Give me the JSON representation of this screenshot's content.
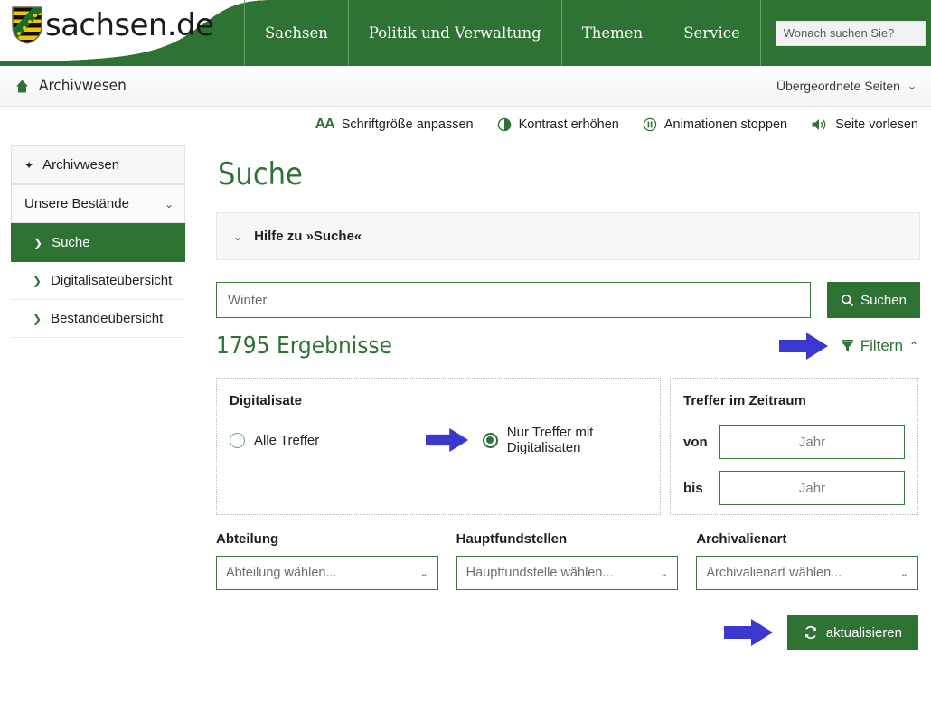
{
  "header": {
    "logo_text": "sachsen.de",
    "logo_icon": "saxony-coat-of-arms",
    "nav_items": [
      {
        "label": "Sachsen"
      },
      {
        "label": "Politik und Verwaltung"
      },
      {
        "label": "Themen"
      },
      {
        "label": "Service"
      }
    ],
    "search": {
      "placeholder": "Wonach suchen Sie?",
      "value": "",
      "button_icon": "search-icon"
    },
    "apps_icon": "grid-apps-icon",
    "green": "#2f7334"
  },
  "breadcrumb": {
    "home_icon": "home-icon",
    "current": "Archivwesen",
    "parent_pages_label": "Übergeordnete Seiten",
    "chevron_icon": "chevron-down-icon"
  },
  "accessibility": [
    {
      "icon": "font-size-icon",
      "label": "Schriftgröße anpassen"
    },
    {
      "icon": "contrast-icon",
      "label": "Kontrast erhöhen"
    },
    {
      "icon": "pause-icon",
      "label": "Animationen stoppen"
    },
    {
      "icon": "speaker-icon",
      "label": "Seite vorlesen"
    }
  ],
  "sidebar": {
    "items": [
      {
        "label": "Archivwesen",
        "bullet": "diamond-icon",
        "state": "header"
      },
      {
        "label": "Unsere Bestände",
        "bullet": "none",
        "state": "collapsible",
        "chevron": "chevron-down-icon"
      },
      {
        "label": "Suche",
        "bullet": "arrow-icon",
        "state": "active"
      },
      {
        "label": "Digitalisateübersicht",
        "bullet": "arrow-icon",
        "state": "normal"
      },
      {
        "label": "Beständeübersicht",
        "bullet": "arrow-icon",
        "state": "normal"
      }
    ]
  },
  "main": {
    "title": "Suche",
    "help": {
      "icon": "chevron-down-icon",
      "label": "Hilfe zu »Suche«"
    },
    "search": {
      "value": "Winter",
      "placeholder": "",
      "button_label": "Suchen",
      "button_icon": "search-icon"
    },
    "results_count": "1795 Ergebnisse",
    "filter": {
      "label": "Filtern",
      "icon": "funnel-icon",
      "chevron": "chevron-up-icon"
    },
    "panel_digitalisate": {
      "title": "Digitalisate",
      "options": [
        {
          "label": "Alle Treffer",
          "selected": false
        },
        {
          "label": "Nur Treffer mit Digitalisaten",
          "selected": true
        }
      ]
    },
    "panel_zeitraum": {
      "title": "Treffer im Zeitraum",
      "from_label": "von",
      "to_label": "bis",
      "from_value": "",
      "to_value": "",
      "from_placeholder": "Jahr",
      "to_placeholder": "Jahr"
    },
    "selects": [
      {
        "label": "Abteilung",
        "value": "Abteilung wählen...",
        "chevron": "chevron-down-icon"
      },
      {
        "label": "Hauptfundstellen",
        "value": "Hauptfundstelle wählen...",
        "chevron": "chevron-down-icon"
      },
      {
        "label": "Archivalienart",
        "value": "Archivalienart wählen...",
        "chevron": "chevron-down-icon"
      }
    ],
    "update_button": {
      "label": "aktualisieren",
      "icon": "refresh-icon"
    },
    "annotation_arrows": [
      {
        "name": "arrow-to-filtern",
        "color": "#3b38cf"
      },
      {
        "name": "arrow-to-digitalisate-radio",
        "color": "#3b38cf"
      },
      {
        "name": "arrow-to-aktualisieren",
        "color": "#3b38cf"
      }
    ]
  }
}
